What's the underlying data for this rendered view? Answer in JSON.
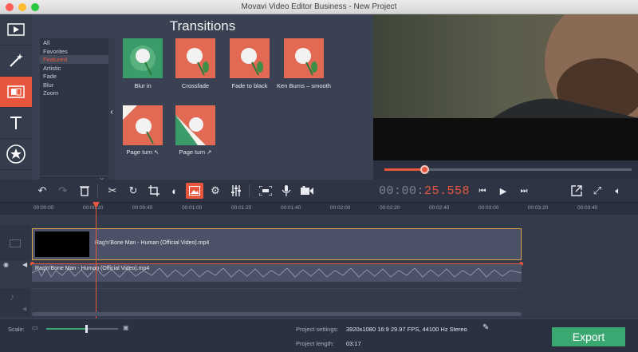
{
  "window": {
    "title": "Movavi Video Editor Business - New Project"
  },
  "sidebar": {
    "tools": [
      {
        "name": "import-media",
        "icon": "film-icon"
      },
      {
        "name": "filters",
        "icon": "magic-wand-icon"
      },
      {
        "name": "transitions",
        "icon": "transitions-icon"
      },
      {
        "name": "titles",
        "icon": "text-icon"
      },
      {
        "name": "stickers",
        "icon": "star-sticker-icon"
      },
      {
        "name": "more",
        "icon": "list-icon"
      }
    ]
  },
  "transitions": {
    "title": "Transitions",
    "categories": [
      "All",
      "Favorites",
      "Featured",
      "Artistic",
      "Fade",
      "Blur",
      "Zoom"
    ],
    "selected_category": "Featured",
    "items": [
      {
        "label": "Blur in"
      },
      {
        "label": "Crossfade"
      },
      {
        "label": "Fade to black"
      },
      {
        "label": "Ken Burns – smooth"
      },
      {
        "label": "Page turn ↖"
      },
      {
        "label": "Page turn ↗"
      }
    ]
  },
  "player": {
    "timecode_main": "00:00:",
    "timecode_accent": "25.558",
    "progress": 0.16
  },
  "ruler": {
    "ticks": [
      "00:00:00",
      "00:00:20",
      "00:00:40",
      "00:01:00",
      "00:01:20",
      "00:01:40",
      "00:02:00",
      "00:02:20",
      "00:02:40",
      "00:03:00",
      "00:03:20",
      "00:03:40"
    ]
  },
  "timeline": {
    "video_clip": "Rag'n'Bone Man - Human (Official Video).mp4",
    "audio_clip": "Rag'n'Bone Man - Human (Official Video).mp4"
  },
  "footer": {
    "scale_label": "Scale:",
    "scale_level": 0.55,
    "settings_label": "Project settings:",
    "settings_value": "3920x1080 16:9 29.97 FPS, 44100 Hz Stereo",
    "length_label": "Project length:",
    "length_value": "03:17",
    "export_label": "Export"
  },
  "colors": {
    "accent": "#e8563e",
    "export": "#3aa870",
    "clip_border": "#d8a24a"
  }
}
